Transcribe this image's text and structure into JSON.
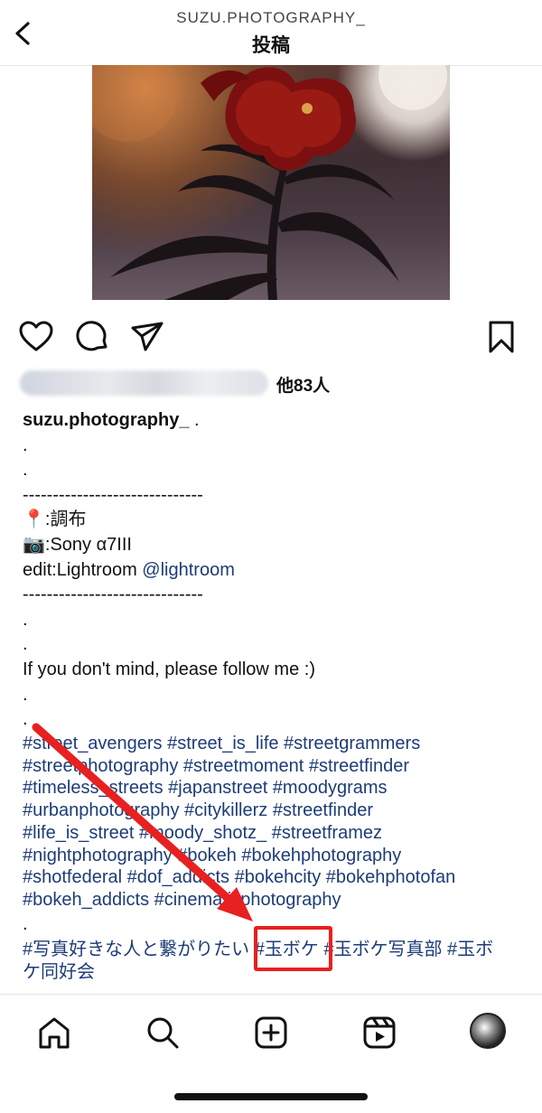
{
  "header": {
    "username": "SUZU.PHOTOGRAPHY_",
    "title": "投稿"
  },
  "post": {
    "likes_suffix": "他83人",
    "caption_lines": [
      {
        "type": "user",
        "username": "suzu.photography_",
        "text": " ."
      },
      {
        "type": "text",
        "text": "."
      },
      {
        "type": "text",
        "text": "."
      },
      {
        "type": "text",
        "text": "------------------------------"
      },
      {
        "type": "text",
        "text": "📍:調布"
      },
      {
        "type": "text",
        "text": "📷:Sony α7III"
      },
      {
        "type": "mention",
        "text": "edit:Lightroom ",
        "mention": "@lightroom"
      },
      {
        "type": "text",
        "text": "------------------------------"
      },
      {
        "type": "text",
        "text": "."
      },
      {
        "type": "text",
        "text": "."
      },
      {
        "type": "text",
        "text": "If you don't mind, please follow me :)"
      },
      {
        "type": "text",
        "text": "."
      },
      {
        "type": "text",
        "text": "."
      }
    ],
    "hashtag_lines": [
      "#street_avengers #street_is_life #streetgrammers",
      "#streetphotography #streetmoment #streetfinder",
      "#timeless_streets #japanstreet #moodygrams",
      "#urbanphotography #citykillerz #streetfinder",
      "#life_is_street #moody_shotz_ #streetframez",
      "#nightphotography #bokeh #bokehphotography",
      "#shotfederal #dof_addicts #bokehcity #bokehphotofan",
      "#bokeh_addicts #cinematicphotography"
    ],
    "dot_line": ".",
    "jp_tags": {
      "line1_before": "#写真好きな人と繋がりたい ",
      "highlight": "#玉ボケ",
      "line1_after": " #玉ボケ写真部 #玉ボ",
      "line2": "ケ同好会"
    }
  },
  "colors": {
    "link": "#1d3c77",
    "highlight": "#e82020"
  },
  "icons": [
    "back-chevron-icon",
    "heart-icon",
    "comment-icon",
    "share-icon",
    "bookmark-icon",
    "home-icon",
    "search-icon",
    "create-icon",
    "reels-icon",
    "profile-avatar"
  ]
}
